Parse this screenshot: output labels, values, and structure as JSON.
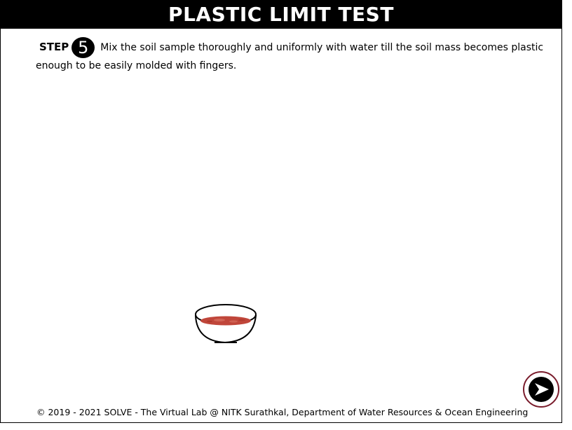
{
  "header": {
    "title": "PLASTIC LIMIT TEST"
  },
  "step": {
    "label": "STEP",
    "number": "5",
    "instruction": "Mix the soil sample thoroughly and uniformly with water till the soil mass becomes plastic enough to be easily molded with fingers."
  },
  "scene": {
    "icon": "bowl-with-wet-soil-icon",
    "soil_color": "#c0463a"
  },
  "navigation": {
    "next_icon": "next-arrow-icon",
    "accent_color": "#7a1c2c"
  },
  "footer": {
    "text": "© 2019 - 2021 SOLVE - The Virtual Lab @ NITK Surathkal, Department of Water Resources & Ocean Engineering"
  }
}
